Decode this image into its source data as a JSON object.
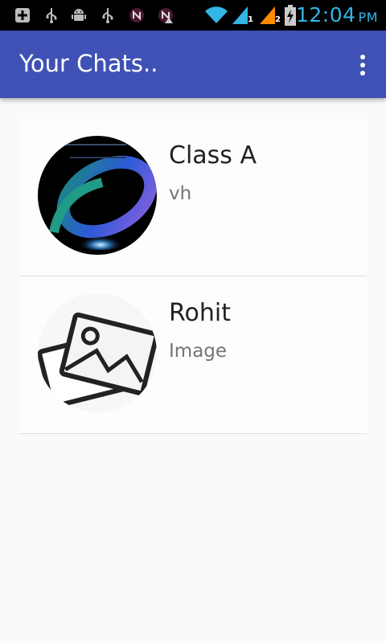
{
  "status_bar": {
    "time": "12:04",
    "ampm": "PM",
    "icons": [
      "add-notification-icon",
      "usb-icon",
      "android-debug-icon",
      "usb-icon",
      "n-app-icon",
      "n-app-alert-icon",
      "wifi-icon",
      "signal-sim1-icon",
      "signal-sim2-icon",
      "battery-charging-icon"
    ],
    "sim_labels": [
      "1",
      "2"
    ]
  },
  "app_bar": {
    "title": "Your Chats..",
    "menu_icon": "overflow-menu-icon",
    "color": "#3f51b5"
  },
  "chats": [
    {
      "name": "Class A",
      "preview": "vh",
      "avatar": "group-photo-avatar"
    },
    {
      "name": "Rohit",
      "preview": "Image",
      "avatar": "image-placeholder-icon"
    }
  ]
}
